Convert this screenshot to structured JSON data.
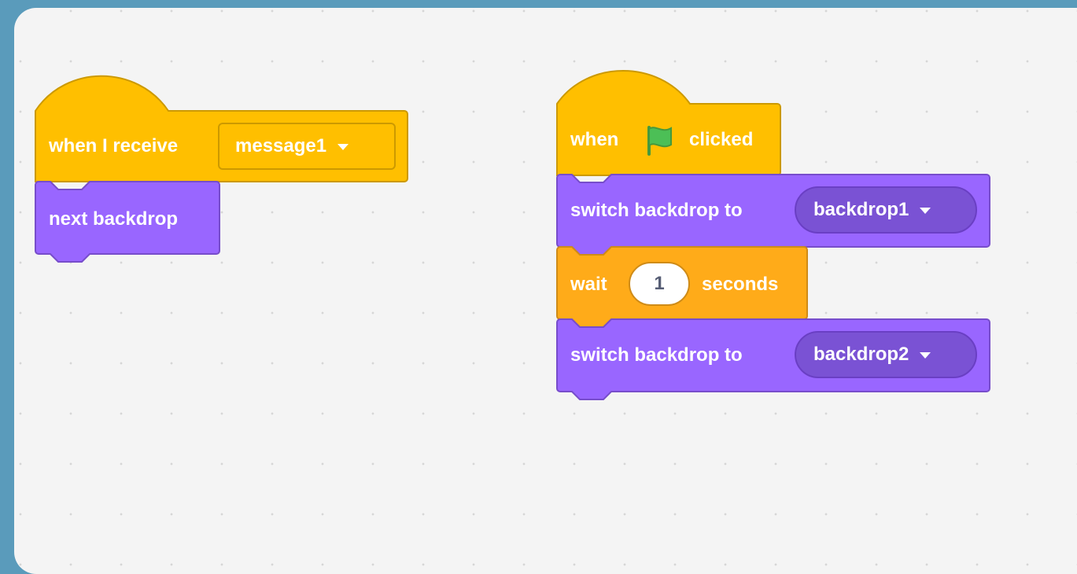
{
  "colors": {
    "events_fill": "#ffbf00",
    "events_border": "#cc9900",
    "looks_fill": "#9966ff",
    "looks_border": "#774dcb",
    "control_fill": "#ffab19",
    "control_border": "#cf8b17",
    "flag_green": "#4cbf56",
    "text": "#ffffff"
  },
  "scripts": [
    {
      "hat": {
        "label": "when I receive",
        "dropdown_value": "message1"
      },
      "blocks": [
        {
          "label": "next backdrop"
        }
      ]
    },
    {
      "hat": {
        "label_before": "when",
        "icon": "green-flag-icon",
        "label_after": "clicked"
      },
      "blocks": [
        {
          "label": "switch backdrop to",
          "dropdown_value": "backdrop1"
        },
        {
          "label_before": "wait",
          "input_value": "1",
          "label_after": "seconds"
        },
        {
          "label": "switch backdrop to",
          "dropdown_value": "backdrop2"
        }
      ]
    }
  ]
}
